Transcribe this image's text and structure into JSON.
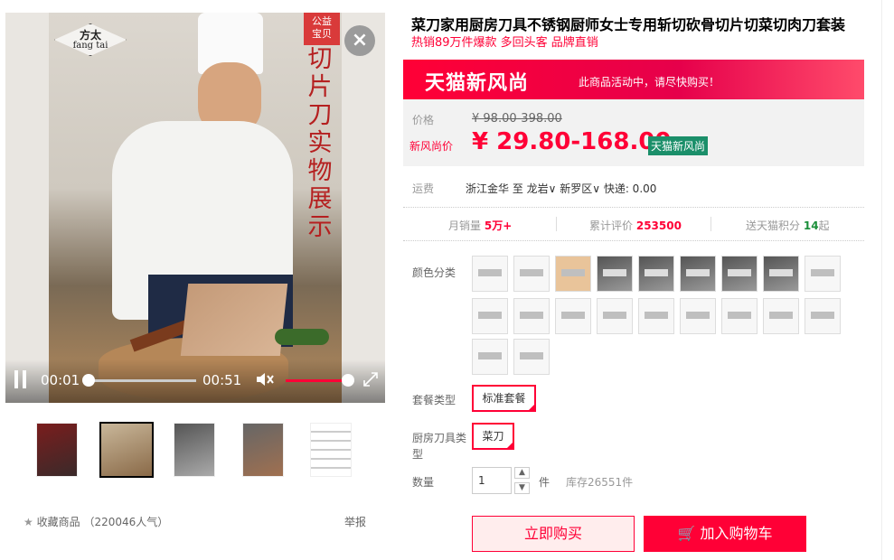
{
  "video": {
    "logo_cn": "方太",
    "logo_en": "fang tai",
    "charity_badge": "公益\n宝贝",
    "overlay_text": "切片刀实物展示",
    "current_time": "00:01",
    "total_time": "00:51",
    "close_icon": "×"
  },
  "thumbnails": [
    "thumb-1",
    "thumb-2",
    "thumb-3",
    "thumb-4",
    "thumb-5"
  ],
  "favorite": {
    "label": "收藏商品",
    "popularity": "（220046人气）"
  },
  "report_label": "举报",
  "product": {
    "title": "菜刀家用厨房刀具不锈钢厨师女士专用斩切砍骨切片切菜切肉刀套装",
    "subtitle": "热销89万件爆款 多回头客 品牌直销"
  },
  "banner": {
    "title": "天猫新风尚",
    "text": "此商品活动中，请尽快购买！"
  },
  "price": {
    "orig_label": "价格",
    "orig_value": "¥ 98.00-398.00",
    "new_label": "新风尚价",
    "new_value": "¥ 29.80-168.00",
    "badge": "天猫新风尚"
  },
  "shipping": {
    "label": "运费",
    "text": "浙江金华  至 龙岩∨ 新罗区∨  快递: 0.00"
  },
  "stats": {
    "monthly_sales_label": "月销量",
    "monthly_sales_value": "5万+",
    "reviews_label": "累计评价",
    "reviews_value": "253500",
    "points_label": "送天猫积分",
    "points_value": "14",
    "points_suffix": "起"
  },
  "color_label": "颜色分类",
  "package": {
    "label": "套餐类型",
    "option": "标准套餐"
  },
  "knife_type": {
    "label": "厨房刀具类型",
    "option": "菜刀"
  },
  "quantity": {
    "label": "数量",
    "value": "1",
    "unit": "件",
    "stock": "库存26551件"
  },
  "buttons": {
    "buy": "立即购买",
    "cart": "加入购物车"
  },
  "colors": {
    "accent": "#ff0036",
    "badge_green": "#1b8f6a"
  }
}
